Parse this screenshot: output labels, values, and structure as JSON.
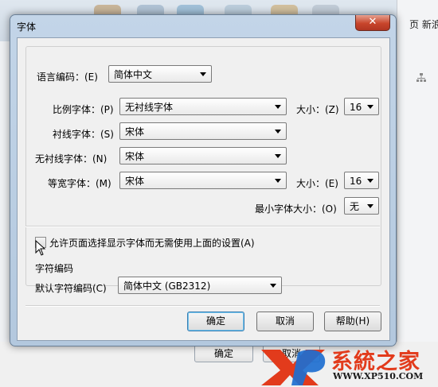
{
  "background": {
    "nav_text": "页 新浪",
    "bottom_buttons": [
      "确定",
      "取消"
    ]
  },
  "dialog": {
    "title": "字体",
    "close_glyph": "✕",
    "language_label": "语言编码：(E)",
    "language_value": "简体中文",
    "proportional_label": "比例字体：(P)",
    "proportional_value": "无衬线字体",
    "serif_label": "衬线字体：(S)",
    "serif_value": "宋体",
    "sans_label": "无衬线字体：(N)",
    "sans_value": "宋体",
    "mono_label": "等宽字体：(M)",
    "mono_value": "宋体",
    "size_label_1": "大小：(Z)",
    "size_value_1": "16",
    "size_label_2": "大小：(E)",
    "size_value_2": "16",
    "min_size_label": "最小字体大小：(O)",
    "min_size_value": "无",
    "allow_pages_label": "允许页面选择显示字体而无需使用上面的设置(A)",
    "allow_pages_checked": false,
    "encoding_group_label": "字符编码",
    "default_encoding_label": "默认字符编码(C)",
    "default_encoding_value": "简体中文 (GB2312)",
    "ok_label": "确定",
    "cancel_label": "取消",
    "help_label": "帮助(H)"
  },
  "watermark": {
    "brand": "系統之家",
    "url": "WWW.XP510.COM"
  },
  "colors": {
    "title_bar": "#b9cde2",
    "close_button": "#c8452b",
    "dialog_body": "#f0f0f0",
    "watermark_red": "#e23b1c",
    "watermark_blue": "#1e6fd0"
  }
}
